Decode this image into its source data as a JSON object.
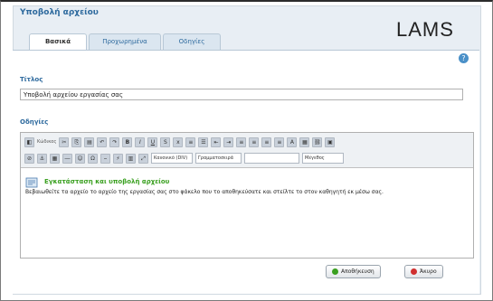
{
  "dialog": {
    "title": "Υποβολή αρχείου",
    "logo": "LAMS",
    "help_glyph": "?"
  },
  "tabs": [
    {
      "label": "Βασικά",
      "active": true
    },
    {
      "label": "Προχωρημένα",
      "active": false
    },
    {
      "label": "Οδηγίες",
      "active": false
    }
  ],
  "form": {
    "title_label": "Τίτλος",
    "title_value": "Υποβολή αρχείου εργασίας σας",
    "instructions_label": "Οδηγίες"
  },
  "toolbar": {
    "source_label": "Κώδικας",
    "style_label": "Κανονικό (DIV)",
    "size_label": "Μέγεθος",
    "font_label": "Γραμματοσειρά"
  },
  "editor": {
    "heading": "Εγκατάσταση και υποβολή αρχείου",
    "text": "Βεβαιωθείτε τα αρχείο το αρχείο της εργασίας σας στο φάκελο που το αποθηκεύσατε και στείλτε το στον καθηγητή εκ μέσω σας."
  },
  "buttons": {
    "save": "Αποθήκευση",
    "cancel": "Άκυρο"
  },
  "colors": {
    "accent": "#2e6a9e",
    "heading_green": "#3aa020",
    "save_icon": "#3aa020",
    "cancel_icon": "#d03030"
  }
}
